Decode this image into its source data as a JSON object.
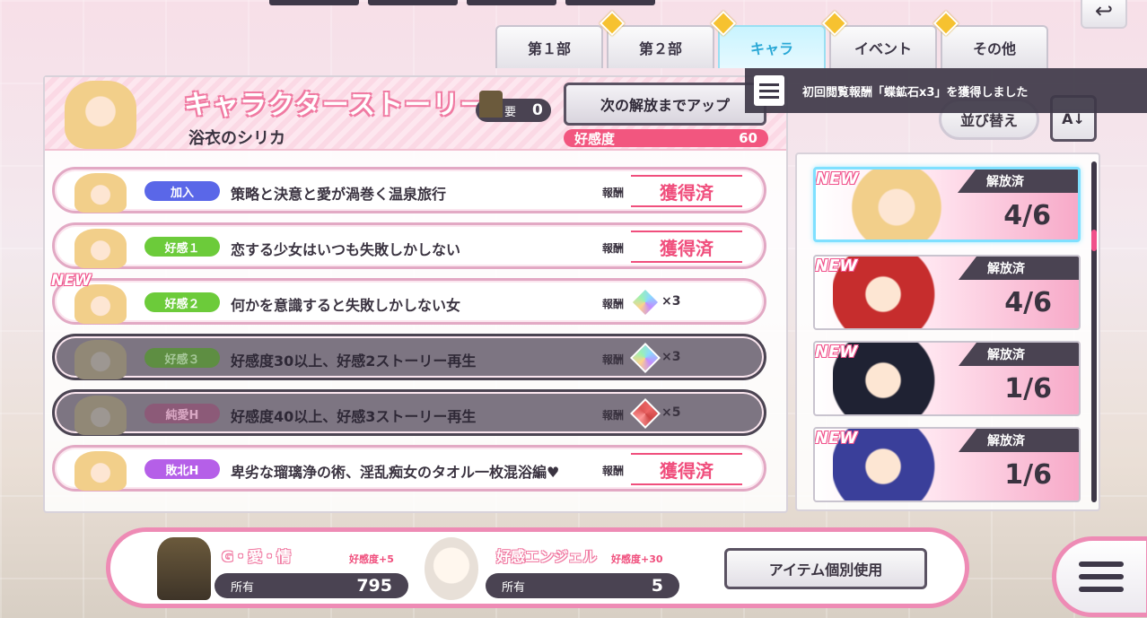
{
  "tabs": [
    {
      "label": "第１部",
      "active": false
    },
    {
      "label": "第２部",
      "active": false
    },
    {
      "label": "キャラ",
      "active": true
    },
    {
      "label": "イベント",
      "active": false
    },
    {
      "label": "その他",
      "active": false
    }
  ],
  "header": {
    "title": "キャラクターストーリー",
    "character_name": "浴衣のシリカ",
    "requirement_label": "要",
    "requirement_value": "0",
    "unlock_button": "次の解放までアップ",
    "affinity_label": "好感度",
    "affinity_value": "60"
  },
  "toast": {
    "message": "初回閲覧報酬「蝶鉱石x3」を獲得しました"
  },
  "sort": {
    "label": "並び替え",
    "direction_icon": "sort-desc-icon"
  },
  "stories": [
    {
      "tag": "加入",
      "title": "策略と決意と愛が渦巻く温泉旅行",
      "reward_label": "報酬",
      "reward": "獲得済",
      "locked": false,
      "is_new": false
    },
    {
      "tag": "好感１",
      "title": "恋する少女はいつも失敗しかしない",
      "reward_label": "報酬",
      "reward": "獲得済",
      "locked": false,
      "is_new": false
    },
    {
      "tag": "好感２",
      "title": "何かを意識すると失敗しかしない女",
      "reward_label": "報酬",
      "reward": "×3",
      "locked": false,
      "is_new": true,
      "new_label": "NEW"
    },
    {
      "tag": "好感３",
      "title": "好感度30以上、好感2ストーリー再生",
      "reward_label": "報酬",
      "reward": "×3",
      "locked": true,
      "is_new": false
    },
    {
      "tag": "純愛H",
      "title": "好感度40以上、好感3ストーリー再生",
      "reward_label": "報酬",
      "reward": "×5",
      "locked": true,
      "is_new": false
    },
    {
      "tag": "敗北H",
      "title": "卑劣な瑠璃浄の術、淫乱痴女のタオル一枚混浴編♥",
      "reward_label": "報酬",
      "reward": "獲得済",
      "locked": false,
      "is_new": false
    }
  ],
  "characters": [
    {
      "new_label": "NEW",
      "status": "解放済",
      "progress": "4/6",
      "selected": true
    },
    {
      "new_label": "NEW",
      "status": "解放済",
      "progress": "4/6",
      "selected": false
    },
    {
      "new_label": "NEW",
      "status": "解放済",
      "progress": "1/6",
      "selected": false
    },
    {
      "new_label": "NEW",
      "status": "解放済",
      "progress": "1/6",
      "selected": false
    }
  ],
  "items": [
    {
      "name": "G・愛・情",
      "bonus": "好感度+5",
      "owned_label": "所有",
      "owned_value": "795"
    },
    {
      "name": "好感エンジェル",
      "bonus": "好感度+30",
      "owned_label": "所有",
      "owned_value": "5"
    }
  ],
  "bottom": {
    "use_button": "アイテム個別使用"
  },
  "colors": {
    "accent_pink": "#f04f7d",
    "active_tab": "#2aa8d6",
    "dark": "#4a4352"
  }
}
